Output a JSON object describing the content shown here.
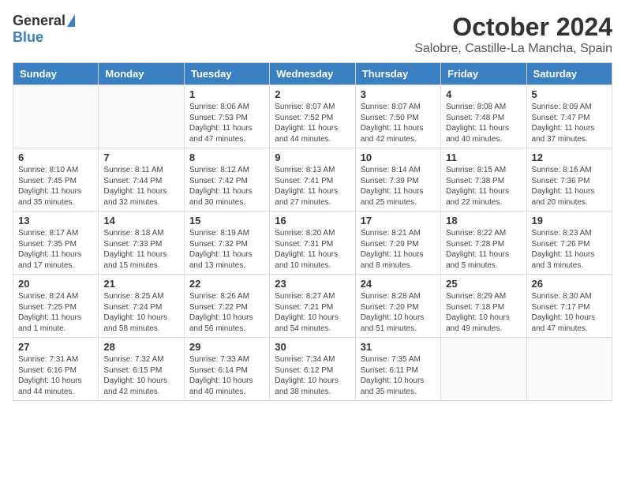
{
  "header": {
    "logo_general": "General",
    "logo_blue": "Blue",
    "month": "October 2024",
    "location": "Salobre, Castille-La Mancha, Spain"
  },
  "weekdays": [
    "Sunday",
    "Monday",
    "Tuesday",
    "Wednesday",
    "Thursday",
    "Friday",
    "Saturday"
  ],
  "weeks": [
    [
      {
        "day": "",
        "info": ""
      },
      {
        "day": "",
        "info": ""
      },
      {
        "day": "1",
        "info": "Sunrise: 8:06 AM\nSunset: 7:53 PM\nDaylight: 11 hours and 47 minutes."
      },
      {
        "day": "2",
        "info": "Sunrise: 8:07 AM\nSunset: 7:52 PM\nDaylight: 11 hours and 44 minutes."
      },
      {
        "day": "3",
        "info": "Sunrise: 8:07 AM\nSunset: 7:50 PM\nDaylight: 11 hours and 42 minutes."
      },
      {
        "day": "4",
        "info": "Sunrise: 8:08 AM\nSunset: 7:48 PM\nDaylight: 11 hours and 40 minutes."
      },
      {
        "day": "5",
        "info": "Sunrise: 8:09 AM\nSunset: 7:47 PM\nDaylight: 11 hours and 37 minutes."
      }
    ],
    [
      {
        "day": "6",
        "info": "Sunrise: 8:10 AM\nSunset: 7:45 PM\nDaylight: 11 hours and 35 minutes."
      },
      {
        "day": "7",
        "info": "Sunrise: 8:11 AM\nSunset: 7:44 PM\nDaylight: 11 hours and 32 minutes."
      },
      {
        "day": "8",
        "info": "Sunrise: 8:12 AM\nSunset: 7:42 PM\nDaylight: 11 hours and 30 minutes."
      },
      {
        "day": "9",
        "info": "Sunrise: 8:13 AM\nSunset: 7:41 PM\nDaylight: 11 hours and 27 minutes."
      },
      {
        "day": "10",
        "info": "Sunrise: 8:14 AM\nSunset: 7:39 PM\nDaylight: 11 hours and 25 minutes."
      },
      {
        "day": "11",
        "info": "Sunrise: 8:15 AM\nSunset: 7:38 PM\nDaylight: 11 hours and 22 minutes."
      },
      {
        "day": "12",
        "info": "Sunrise: 8:16 AM\nSunset: 7:36 PM\nDaylight: 11 hours and 20 minutes."
      }
    ],
    [
      {
        "day": "13",
        "info": "Sunrise: 8:17 AM\nSunset: 7:35 PM\nDaylight: 11 hours and 17 minutes."
      },
      {
        "day": "14",
        "info": "Sunrise: 8:18 AM\nSunset: 7:33 PM\nDaylight: 11 hours and 15 minutes."
      },
      {
        "day": "15",
        "info": "Sunrise: 8:19 AM\nSunset: 7:32 PM\nDaylight: 11 hours and 13 minutes."
      },
      {
        "day": "16",
        "info": "Sunrise: 8:20 AM\nSunset: 7:31 PM\nDaylight: 11 hours and 10 minutes."
      },
      {
        "day": "17",
        "info": "Sunrise: 8:21 AM\nSunset: 7:29 PM\nDaylight: 11 hours and 8 minutes."
      },
      {
        "day": "18",
        "info": "Sunrise: 8:22 AM\nSunset: 7:28 PM\nDaylight: 11 hours and 5 minutes."
      },
      {
        "day": "19",
        "info": "Sunrise: 8:23 AM\nSunset: 7:26 PM\nDaylight: 11 hours and 3 minutes."
      }
    ],
    [
      {
        "day": "20",
        "info": "Sunrise: 8:24 AM\nSunset: 7:25 PM\nDaylight: 11 hours and 1 minute."
      },
      {
        "day": "21",
        "info": "Sunrise: 8:25 AM\nSunset: 7:24 PM\nDaylight: 10 hours and 58 minutes."
      },
      {
        "day": "22",
        "info": "Sunrise: 8:26 AM\nSunset: 7:22 PM\nDaylight: 10 hours and 56 minutes."
      },
      {
        "day": "23",
        "info": "Sunrise: 8:27 AM\nSunset: 7:21 PM\nDaylight: 10 hours and 54 minutes."
      },
      {
        "day": "24",
        "info": "Sunrise: 8:28 AM\nSunset: 7:20 PM\nDaylight: 10 hours and 51 minutes."
      },
      {
        "day": "25",
        "info": "Sunrise: 8:29 AM\nSunset: 7:18 PM\nDaylight: 10 hours and 49 minutes."
      },
      {
        "day": "26",
        "info": "Sunrise: 8:30 AM\nSunset: 7:17 PM\nDaylight: 10 hours and 47 minutes."
      }
    ],
    [
      {
        "day": "27",
        "info": "Sunrise: 7:31 AM\nSunset: 6:16 PM\nDaylight: 10 hours and 44 minutes."
      },
      {
        "day": "28",
        "info": "Sunrise: 7:32 AM\nSunset: 6:15 PM\nDaylight: 10 hours and 42 minutes."
      },
      {
        "day": "29",
        "info": "Sunrise: 7:33 AM\nSunset: 6:14 PM\nDaylight: 10 hours and 40 minutes."
      },
      {
        "day": "30",
        "info": "Sunrise: 7:34 AM\nSunset: 6:12 PM\nDaylight: 10 hours and 38 minutes."
      },
      {
        "day": "31",
        "info": "Sunrise: 7:35 AM\nSunset: 6:11 PM\nDaylight: 10 hours and 35 minutes."
      },
      {
        "day": "",
        "info": ""
      },
      {
        "day": "",
        "info": ""
      }
    ]
  ]
}
